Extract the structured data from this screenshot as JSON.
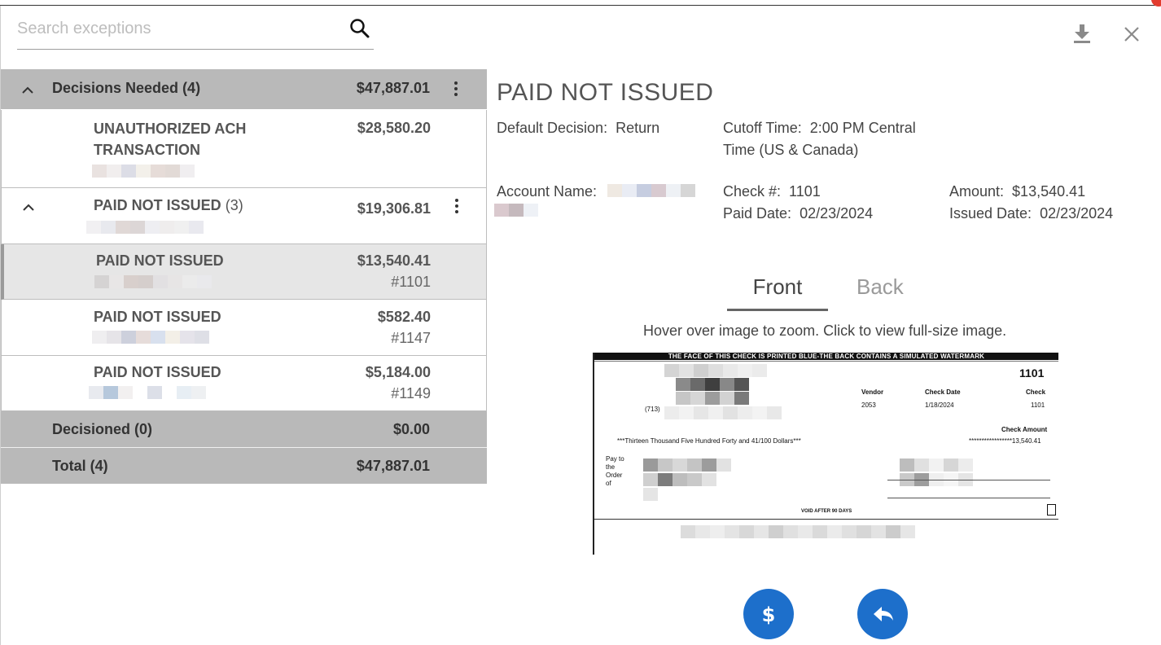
{
  "colors": {
    "accent": "#1d6fcb",
    "group_bg": "#b9b9b9",
    "selected_bg": "#e6e6e6"
  },
  "search": {
    "placeholder": "Search exceptions",
    "icon": "search-icon"
  },
  "sidebar": {
    "decisions_needed": {
      "label": "Decisions Needed (4)",
      "amount": "$47,887.01"
    },
    "items": [
      {
        "title_line1": "UNAUTHORIZED ACH",
        "title_line2": "TRANSACTION",
        "amount": "$28,580.20"
      },
      {
        "title": "PAID NOT ISSUED",
        "count": "(3)",
        "amount": "$19,306.81"
      },
      {
        "title": "PAID NOT ISSUED",
        "amount": "$13,540.41",
        "check": "#1101"
      },
      {
        "title": "PAID NOT ISSUED",
        "amount": "$582.40",
        "check": "#1147"
      },
      {
        "title": "PAID NOT ISSUED",
        "amount": "$5,184.00",
        "check": "#1149"
      }
    ],
    "decisioned": {
      "label": "Decisioned (0)",
      "amount": "$0.00"
    },
    "total": {
      "label": "Total (4)",
      "amount": "$47,887.01"
    }
  },
  "toolbar": {
    "download_icon": "download-icon",
    "close_icon": "close-icon"
  },
  "detail": {
    "title": "PAID NOT ISSUED",
    "default_decision_label": "Default Decision:",
    "default_decision": "Return",
    "cutoff_label": "Cutoff Time:",
    "cutoff_line1": "2:00 PM Central",
    "cutoff_line2": "Time (US & Canada)",
    "account_name_label": "Account Name:",
    "check_no_label": "Check #:",
    "check_no": "1101",
    "amount_label": "Amount:",
    "amount": "$13,540.41",
    "paid_date_label": "Paid Date:",
    "paid_date": "02/23/2024",
    "issued_date_label": "Issued Date:",
    "issued_date": "02/23/2024"
  },
  "tabs": {
    "front": "Front",
    "back": "Back",
    "active": "Front"
  },
  "hint": "Hover over image to zoom. Click to view full-size image.",
  "check_image": {
    "banner": "THE FACE OF THIS CHECK IS PRINTED BLUE-THE BACK CONTAINS A SIMULATED WATERMARK",
    "number": "1101",
    "vendor_label": "Vendor",
    "vendor": "2053",
    "check_date_label": "Check Date",
    "check_date": "1/18/2024",
    "check_label": "Check",
    "check_value": "1101",
    "check_amount_label": "Check Amount",
    "check_amount": "*****************13,540.41",
    "phone": "(713)",
    "words": "***Thirteen Thousand Five Hundred Forty and 41/100 Dollars***",
    "pay_to_1": "Pay to",
    "pay_to_2": "the",
    "pay_to_3": "Order",
    "pay_to_4": "of",
    "void": "VOID AFTER 90 DAYS"
  },
  "actions": {
    "pay_icon": "dollar-icon",
    "return_icon": "reply-icon"
  }
}
